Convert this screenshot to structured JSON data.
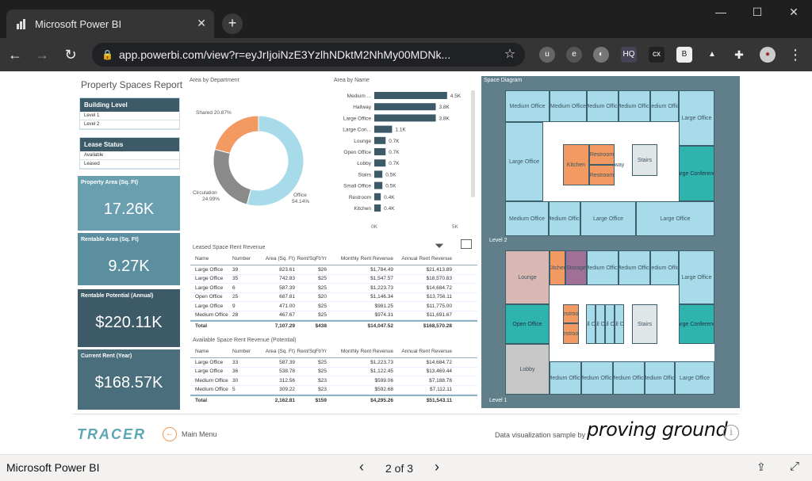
{
  "browser": {
    "tab_title": "Microsoft Power BI",
    "new_tab": "+",
    "url": "app.powerbi.com/view?r=eyJrIjoiNzE3YzlhNDktM2NhMy00MDNk...",
    "tab_close": "✕",
    "minimize": "—",
    "maximize": "☐",
    "close": "✕"
  },
  "report": {
    "title": "Property Spaces Report",
    "building_level": {
      "header": "Building Level",
      "items": [
        "Level 1",
        "Level 2"
      ]
    },
    "lease_status": {
      "header": "Lease Status",
      "items": [
        "Available",
        "Leased"
      ]
    },
    "kpis": [
      {
        "label": "Property Area (Sq. Ft)",
        "value": "17.26K",
        "color": "#6a9fb0"
      },
      {
        "label": "Rentable Area (Sq. Ft)",
        "value": "9.27K",
        "color": "#5b8fa0"
      },
      {
        "label": "Rentable Potential (Annual)",
        "value": "$220.11K",
        "color": "#3c5a67"
      },
      {
        "label": "Current Rent (Year)",
        "value": "$168.57K",
        "color": "#4a6e7b"
      }
    ],
    "donut": {
      "title": "Area by Department",
      "labels": [
        {
          "text": "Shared 20.87%"
        },
        {
          "text": "Circulation"
        },
        {
          "text": "24.99%"
        },
        {
          "text": "Office"
        },
        {
          "text": "54.14%"
        }
      ]
    },
    "bar_title": "Area by Name",
    "axis": {
      "min": "0K",
      "max": "5K"
    },
    "leased_table": {
      "title": "Leased Space Rent Revenue",
      "columns": [
        "Name",
        "Number",
        "Area (Sq. Ft)",
        "Rent/SqFt/Yr",
        "Monthly Rent Revenue",
        "Annual Rent Revenue"
      ],
      "rows": [
        [
          "Large Office",
          "39",
          "823.61",
          "$26",
          "$1,784.49",
          "$21,413.89"
        ],
        [
          "Large Office",
          "35",
          "742.83",
          "$25",
          "$1,547.57",
          "$18,570.83"
        ],
        [
          "Large Office",
          "6",
          "587.39",
          "$25",
          "$1,223.73",
          "$14,684.72"
        ],
        [
          "Open Office",
          "25",
          "687.81",
          "$20",
          "$1,146.34",
          "$13,756.11"
        ],
        [
          "Large Office",
          "9",
          "471.00",
          "$25",
          "$981.25",
          "$11,775.00"
        ],
        [
          "Medium Office",
          "28",
          "467.67",
          "$25",
          "$974.31",
          "$11,691.67"
        ]
      ],
      "total": [
        "Total",
        "",
        "7,107.29",
        "$438",
        "$14,047.52",
        "$168,570.28"
      ]
    },
    "available_table": {
      "title": "Available Space Rent Revenue (Potential)",
      "columns": [
        "Name",
        "Number",
        "Area (Sq. Ft)",
        "Rent/SqFt/Yr",
        "Monthly Rent Revenue",
        "Annual Rent Revenue"
      ],
      "rows": [
        [
          "Large Office",
          "33",
          "587.39",
          "$25",
          "$1,223.73",
          "$14,684.72"
        ],
        [
          "Large Office",
          "36",
          "538.78",
          "$25",
          "$1,122.45",
          "$13,469.44"
        ],
        [
          "Medium Office",
          "30",
          "312.56",
          "$23",
          "$599.06",
          "$7,188.78"
        ],
        [
          "Medium Office",
          "5",
          "309.22",
          "$23",
          "$592.68",
          "$7,112.11"
        ]
      ],
      "total": [
        "Total",
        "",
        "2,162.81",
        "$159",
        "$4,295.26",
        "$51,543.11"
      ]
    },
    "space_diagram": {
      "title": "Space Diagram",
      "level2": "Level 2",
      "level1": "Level 1"
    },
    "footer": {
      "logo": "TRACER",
      "main_menu": "Main Menu",
      "credit": "Data visualization sample by",
      "brand": "proving ground",
      "info": "i"
    }
  },
  "chart_data": [
    {
      "type": "pie",
      "title": "Area by Department",
      "categories": [
        "Office",
        "Circulation",
        "Shared"
      ],
      "values": [
        54.14,
        24.99,
        20.87
      ],
      "colors": [
        "#a8dbe9",
        "#8a8a8a",
        "#f29a61"
      ]
    },
    {
      "type": "bar",
      "title": "Area by Name",
      "categories": [
        "Medium ...",
        "Hallway",
        "Large Office",
        "Large Con...",
        "Lounge",
        "Open Office",
        "Lobby",
        "Stairs",
        "Small Office",
        "Restroom",
        "Kitchen"
      ],
      "values": [
        4.5,
        3.8,
        3.8,
        1.1,
        0.7,
        0.7,
        0.7,
        0.5,
        0.5,
        0.4,
        0.4
      ],
      "data_labels": [
        "4.5K",
        "3.8K",
        "3.8K",
        "1.1K",
        "0.7K",
        "0.7K",
        "0.7K",
        "0.5K",
        "0.5K",
        "0.4K",
        "0.4K"
      ],
      "xlim": [
        0,
        5
      ],
      "bar_color": "#3c5a67"
    }
  ],
  "bottom": {
    "title": "Microsoft Power BI",
    "page": "2 of 3"
  }
}
